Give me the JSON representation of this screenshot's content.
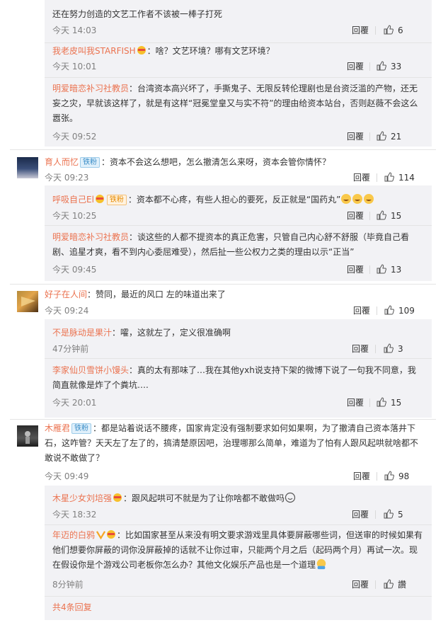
{
  "comments": [
    {
      "text": "还在努力创造的文艺工作者不该被一棒子打死",
      "time": "今天 14:03",
      "reply": "回覆",
      "likes": "6"
    },
    {
      "user": "我老皮叫我STARFISH",
      "text": "：啥？文艺环境？哪有文艺环境？",
      "time": "今天 10:01",
      "reply": "回覆",
      "likes": "33"
    },
    {
      "user": "明爱暗恋补习社教员",
      "text": "：台湾资本高兴坏了，手撕鬼子、无限反转伦理剧也是台资泛滥的产物，还无妄之灾，早就该这样了，就是有这样“冠冕堂皇又与实不符”的理由给资本站台，否则赵薇不会这么嚣张。",
      "time": "今天 09:52",
      "reply": "回覆",
      "likes": "21"
    },
    {
      "user": "育人而忆",
      "badge": "铁粉",
      "text": "：资本不会这么想吧，怎么撤清怎么来呀，资本会管你情怀？",
      "time": "今天 09:23",
      "reply": "回覆",
      "likes": "114"
    },
    {
      "user": "呼吸自己El",
      "badge": "铁粉",
      "text": "：资本都不心疼，有些人担心的要死，反正就是“国药丸”",
      "time": "今天 10:25",
      "reply": "回覆",
      "likes": "15"
    },
    {
      "user": "明爱暗恋补习社教员",
      "text": "：谈这些的人都不提资本的真正危害，只管自己内心舒不舒服（毕竟自己看剧、追星才爽，看不到内心委屈难受），然后扯一些公权力之类的理由以示“正当”",
      "time": "今天 09:45",
      "reply": "回覆",
      "likes": "13"
    },
    {
      "user": "好子在人间",
      "text": "：赞同，最近的风口 左的味道出来了",
      "time": "今天 09:24",
      "reply": "回覆",
      "likes": "109"
    },
    {
      "user": "不是脉动是果汁",
      "text": "：嚯，这就左了，定义很准确啊",
      "time": "47分钟前",
      "reply": "回覆",
      "likes": "3"
    },
    {
      "user": "李家仙贝雪饼小馒头",
      "text": "：真的太有那味了…我在其他yxh说支持下架的微博下说了一句我不同意，我简直就像是炸了个粪坑….",
      "time": "今天 20:01",
      "reply": "回覆",
      "likes": "15"
    },
    {
      "user": "木雁君",
      "badge": "铁粉",
      "text": "：都是站着说话不腰疼，国家肯定没有强制要求如何如果啊，为了撤清自己资本落井下石，这咋管？天天左了左了的，搞清楚原因吧，治理哪那么简单，难道为了怕有人跟风起哄就啥都不敢说不敢做了？",
      "time": "今天 09:49",
      "reply": "回覆",
      "likes": "98"
    },
    {
      "user": "木星少女刘培强",
      "text": "：跟风起哄可不就是为了让你啥都不敢做吗",
      "time": "今天 18:32",
      "reply": "回覆",
      "likes": "5"
    },
    {
      "user": "年迈的白鸦",
      "text": "：比如国家甚至从来没有明文要求游戏里具体要屏蔽哪些词，但送审的时候如果有他们想要你屏蔽的词你没屏蔽掉的话就不让你过审，只能两个月之后（起码两个月）再试一次。现在假设你是个游戏公司老板你怎么办？其他文化娱乐产品也是一个道理",
      "time": "8分钟前",
      "reply": "回覆",
      "likes": "讚"
    }
  ],
  "more_replies": "共4条回复",
  "colors": {
    "username": "#eb7350",
    "panel": "#f2f2f5",
    "meta": "#808080"
  }
}
